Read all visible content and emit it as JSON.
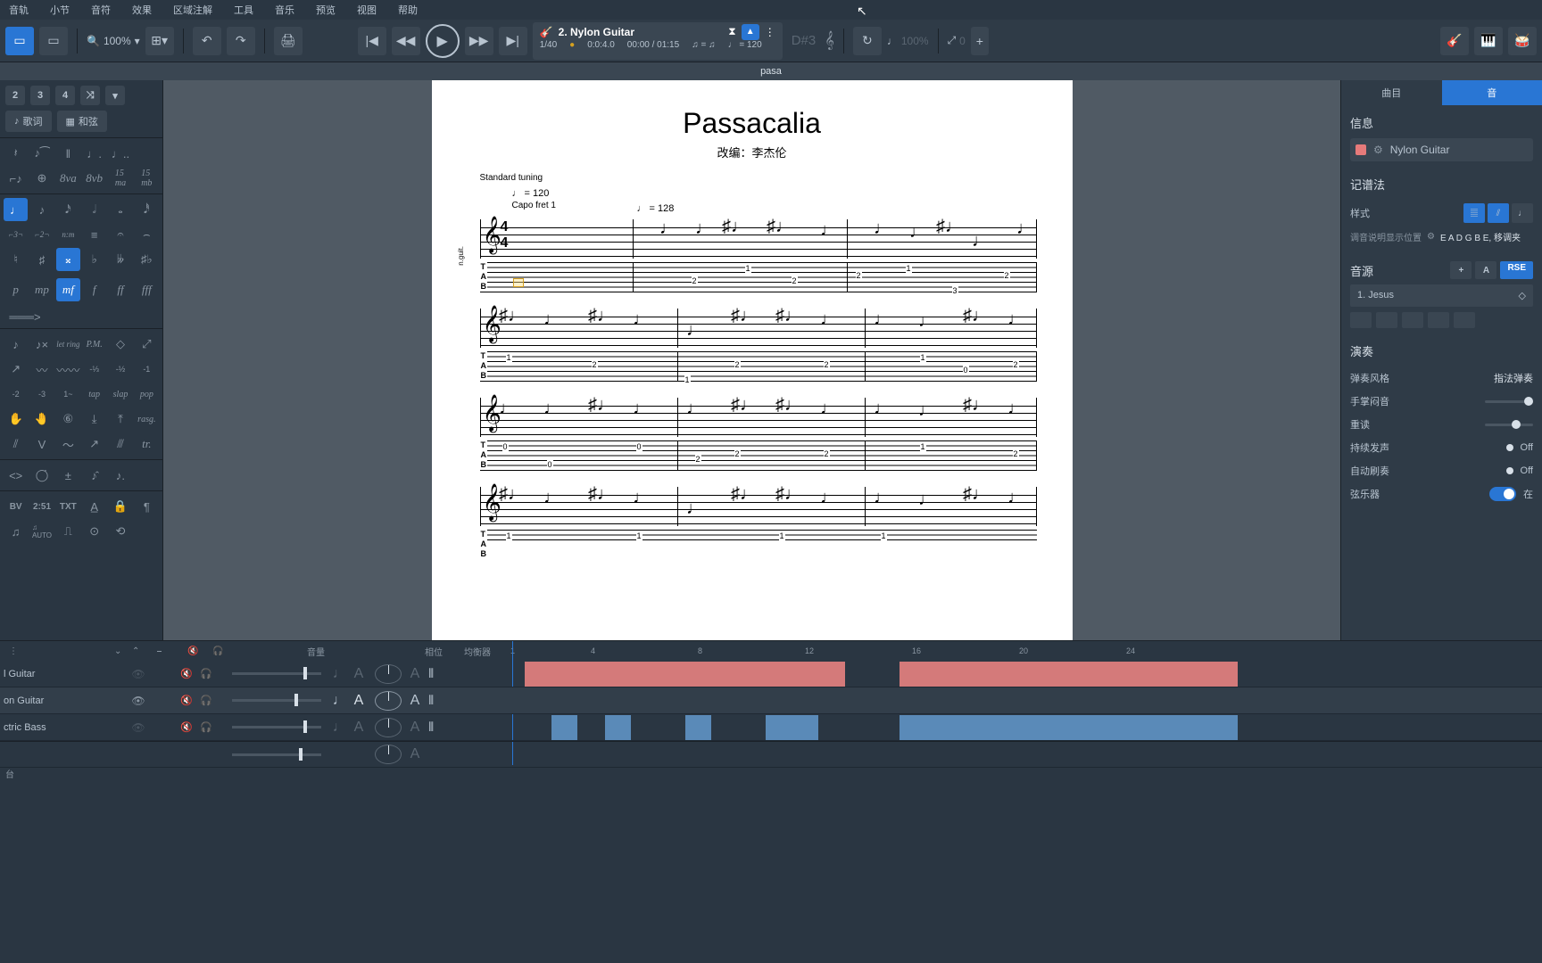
{
  "menu": [
    "音轨",
    "小节",
    "音符",
    "效果",
    "区域注解",
    "工具",
    "音乐",
    "预览",
    "视图",
    "帮助"
  ],
  "toolbar": {
    "zoom": "100%",
    "track_name": "2. Nylon Guitar",
    "chord_disp": "D#3",
    "bar_pos": "1/40",
    "beat_pos": "0:0:4.0",
    "time": "00:00 / 01:15",
    "tempo": "120",
    "loop_pct": "100%",
    "transp": "0"
  },
  "tab_name": "pasa",
  "left": {
    "voices": [
      "2",
      "3",
      "4"
    ],
    "lyric": "歌词",
    "chord": "和弦",
    "dynamics": [
      "p",
      "mp",
      "mf",
      "f",
      "ff",
      "fff"
    ],
    "techniques_row1": [
      "let ring",
      "P.M."
    ],
    "fret_hand": [
      "-⅓",
      "-½",
      "-1",
      "-2",
      "-3",
      "1~"
    ],
    "techniques_row2": [
      "tap",
      "slap",
      "pop"
    ],
    "rasg": "rasg.",
    "bottom": [
      "BV",
      "2:51",
      "TXT"
    ]
  },
  "score": {
    "title": "Passacalia",
    "subtitle": "改编：李杰伦",
    "tuning": "Standard tuning",
    "tempo1": "♩ = 120",
    "tempo2": "♩ = 128",
    "capo": "Capo fret 1",
    "label": "n.guit.",
    "tab_letters": "T\nA\nB",
    "timesig_top": "4",
    "timesig_bot": "4"
  },
  "right": {
    "tab1": "曲目",
    "tab2": "音",
    "info": "信息",
    "track": "Nylon Guitar",
    "notation": "记谱法",
    "style_label": "样式",
    "tuning_label": "调音说明显示位置",
    "tuning_text": "E A D G B E, 移调夹",
    "sound": "音源",
    "sound_item": "1. Jesus",
    "perf": "演奏",
    "play_style_label": "弹奏风格",
    "play_style_val": "指法弹奏",
    "palm_mute": "手掌闷音",
    "accent": "重读",
    "sustain": "持续发声",
    "sustain_val": "Off",
    "auto_brush": "自动刷奏",
    "auto_brush_val": "Off",
    "strings": "弦乐器",
    "strings_val": "在"
  },
  "mixer": {
    "vol_label": "音量",
    "pan_label": "相位",
    "eq_label": "均衡器",
    "ruler": [
      "1",
      "4",
      "8",
      "12",
      "16",
      "20",
      "24"
    ],
    "tracks": [
      "l Guitar",
      "on Guitar",
      "ctric Bass"
    ],
    "footer": "台"
  }
}
